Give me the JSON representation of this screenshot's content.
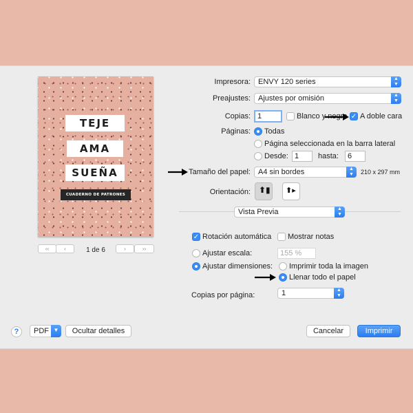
{
  "preview": {
    "cover_words": [
      "TEJE",
      "AMA",
      "SUEÑA"
    ],
    "cover_subtitle": "CUADERNO DE PATRONES",
    "first_btn": "‹‹",
    "prev_btn": "‹",
    "page_indicator": "1 de 6",
    "next_btn": "›",
    "last_btn": "››"
  },
  "printer": {
    "label": "Impresora:",
    "value": "ENVY 120 series"
  },
  "presets": {
    "label": "Preajustes:",
    "value": "Ajustes por omisión"
  },
  "copies": {
    "label": "Copias:",
    "value": "1",
    "bw_label": "Blanco y negro",
    "duplex_label": "A doble cara",
    "bw_checked": false,
    "duplex_checked": true
  },
  "pages": {
    "label": "Páginas:",
    "all_label": "Todas",
    "selected_label": "Página seleccionada en la barra lateral",
    "from_label": "Desde:",
    "from_value": "1",
    "to_label": "hasta:",
    "to_value": "6"
  },
  "paper": {
    "label": "Tamaño del papel:",
    "value": "A4 sin bordes",
    "dims": "210 x 297 mm"
  },
  "orientation": {
    "label": "Orientación:"
  },
  "section_popup": {
    "value": "Vista Previa"
  },
  "auto_rotate": {
    "label": "Rotación automática",
    "checked": true
  },
  "show_notes": {
    "label": "Mostrar notas",
    "checked": false
  },
  "scale": {
    "label": "Ajustar escala:",
    "value": "155 %"
  },
  "fit": {
    "label": "Ajustar dimensiones:",
    "print_entire": "Imprimir toda la imagen",
    "fill_paper": "Llenar todo el papel"
  },
  "copies_per_page": {
    "label": "Copias por página:",
    "value": "1"
  },
  "footer": {
    "help": "?",
    "pdf": "PDF",
    "hide_details": "Ocultar detalles",
    "cancel": "Cancelar",
    "print": "Imprimir"
  },
  "colors": {
    "accent": "#2c7ef0",
    "background": "#e8b9a8",
    "dialog": "#ececec",
    "cover": "#e6b0a1"
  }
}
